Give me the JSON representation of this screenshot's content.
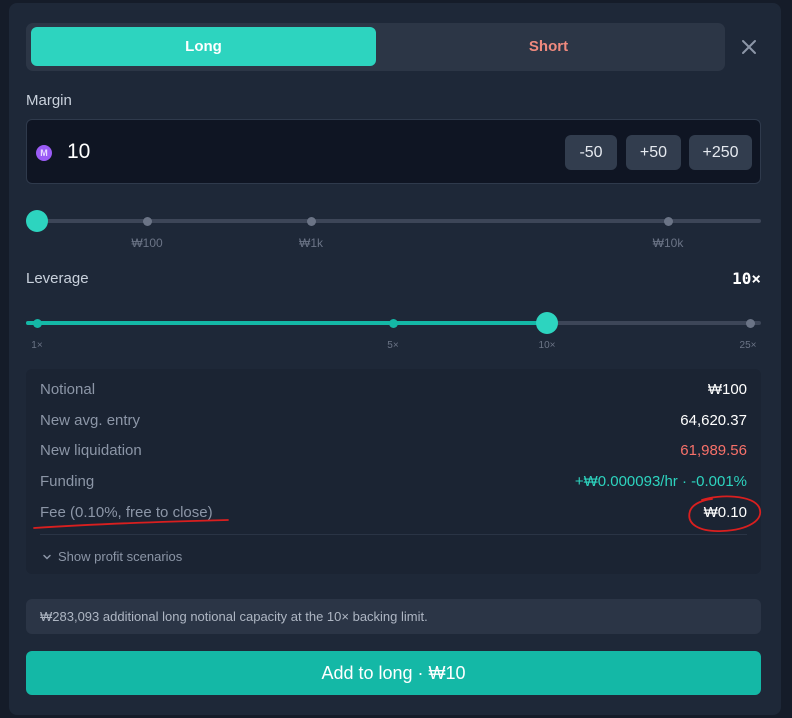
{
  "tabs": {
    "long": "Long",
    "short": "Short"
  },
  "margin": {
    "label": "Margin",
    "currency_symbol": "M",
    "value": "10",
    "quick": [
      "-50",
      "+50",
      "+250"
    ],
    "ticks": [
      "₩100",
      "₩1k",
      "₩10k"
    ],
    "slider_level": 0
  },
  "leverage": {
    "label": "Leverage",
    "value": "10×",
    "ticks": [
      "1×",
      "5×",
      "10×",
      "25×"
    ],
    "selected": 10,
    "min": 1,
    "max": 25
  },
  "summary": {
    "rows": [
      {
        "key": "Notional",
        "value": "₩100",
        "tone": "white"
      },
      {
        "key": "New avg. entry",
        "value": "64,620.37",
        "tone": "white"
      },
      {
        "key": "New liquidation",
        "value": "61,989.56",
        "tone": "red"
      },
      {
        "key": "Funding",
        "value": "+₩0.000093/hr · -0.001%",
        "tone": "teal"
      },
      {
        "key": "Fee (0.10%, free to close)",
        "value": "₩0.10",
        "tone": "white"
      }
    ],
    "scenarios": "Show profit scenarios"
  },
  "note": "₩283,093 additional long notional capacity at the 10× backing limit.",
  "submit": "Add to long · ₩10",
  "colors": {
    "accent": "#2dd4bf",
    "button": "#14b8a6",
    "short": "#f08a7e",
    "negative": "#f8716a",
    "annotation": "#d91f1f"
  }
}
